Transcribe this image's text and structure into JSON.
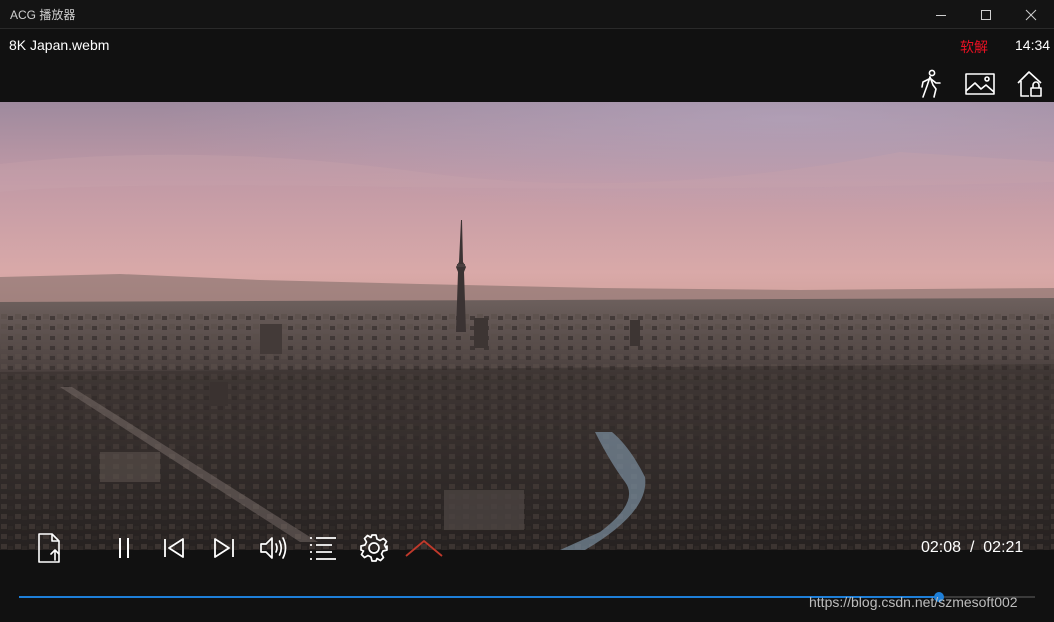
{
  "window": {
    "title": "ACG 播放器",
    "controls": [
      "minimize-icon",
      "maximize-icon",
      "close-icon"
    ]
  },
  "info": {
    "file_name": "8K Japan.webm",
    "decode_mode": "软解",
    "clock": "14:34",
    "icons": [
      "walking-person-icon",
      "image-icon",
      "lock-house-icon"
    ]
  },
  "playback": {
    "current_time": "02:08",
    "separator": "/",
    "total_time": "02:21",
    "progress": 0.906,
    "state": "playing",
    "accent_color": "#1e7fd8"
  },
  "control_icons": [
    "open-file-icon",
    "pause-icon",
    "previous-icon",
    "next-icon",
    "volume-icon",
    "playlist-icon",
    "settings-icon",
    "collapse-chevron-icon"
  ],
  "watermark": "https://blog.csdn.net/szmesoft002"
}
